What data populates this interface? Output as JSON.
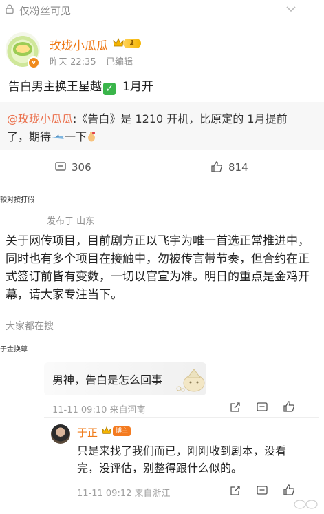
{
  "topbar": {
    "label": "仅粉丝可见"
  },
  "post": {
    "author": "玫珑小瓜瓜",
    "level": "1",
    "time": "昨天 22:35",
    "edited": "已编辑",
    "text": "告白男主换王星越",
    "text_month": "1月开",
    "repost": {
      "mention": "@玫珑小瓜瓜",
      "text_line1": ":《告白》是 1210 开机，比原定的 1月提前",
      "text_line2a": "了，期待",
      "text_line2b": "一下"
    },
    "comment_count": "306",
    "like_count": "814"
  },
  "separator1": "较对按打假",
  "statement": {
    "published": "发布于 山东",
    "text": "关于网传项目，目前剧方正以飞宇为唯一首选正常推进中，同时也有多个项目在接触中，勿被传言带节奏，但合约在正式签订前皆有变数，一切以官宣为准。明日的重点是金鸡开幕，请大家专注当下。"
  },
  "hot_search": "大家都在搜",
  "separator2": "于金换尊",
  "comments": [
    {
      "text": "男神，告白是怎么回事",
      "meta": "11-11 09:10  来自河南"
    },
    {
      "author": "于正",
      "badge": "博主",
      "text": "只是来找了我们而已，刚刚收到剧本，没看完，没评估，别整得跟什么似的。",
      "meta": "11-11 09:12  来自浙江"
    }
  ],
  "colors": {
    "accent": "#ef7b1a",
    "mention": "#eb7350",
    "muted": "#939393"
  }
}
